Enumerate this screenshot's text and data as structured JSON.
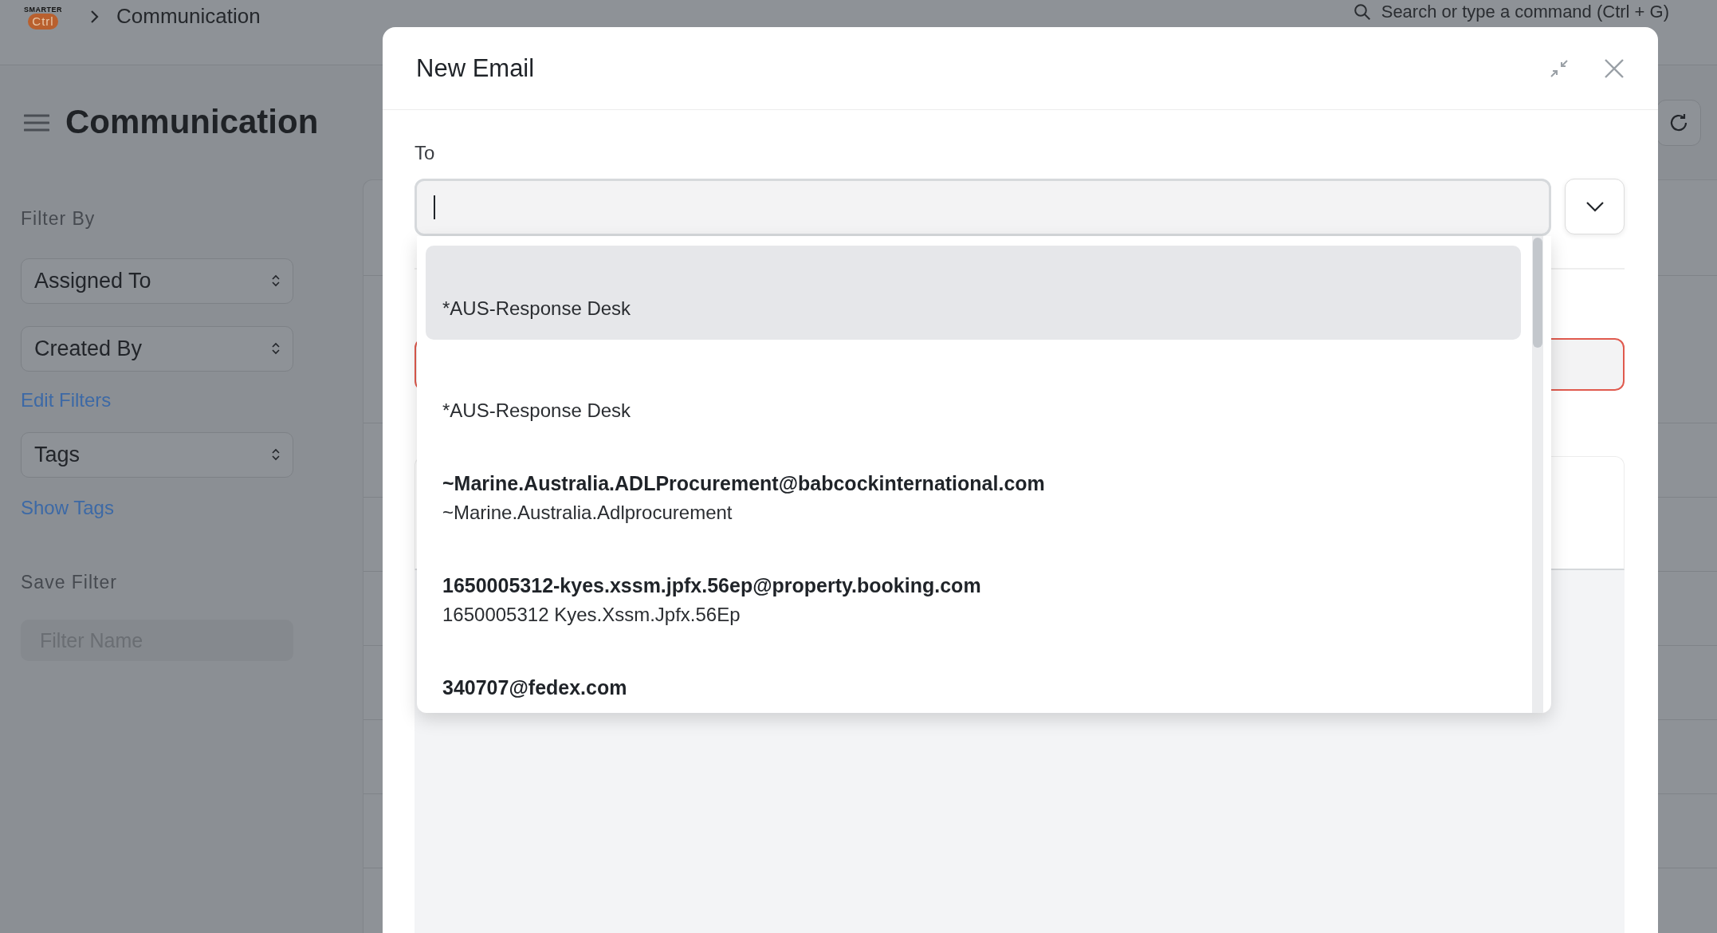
{
  "navbar": {
    "logo": {
      "top": "SMARTER",
      "main": "Ctrl"
    },
    "breadcrumb": "Communication",
    "search_placeholder": "Search or type a command (Ctrl + G)"
  },
  "page": {
    "title": "Communication"
  },
  "sidebar": {
    "filter_heading": "Filter By",
    "filters": [
      {
        "label": "Assigned To"
      },
      {
        "label": "Created By"
      }
    ],
    "edit_filters_link": "Edit Filters",
    "tags_select": "Tags",
    "show_tags_link": "Show Tags",
    "save_heading": "Save Filter",
    "filter_name_placeholder": "Filter Name"
  },
  "modal": {
    "title": "New Email",
    "to_label": "To",
    "suggestions": [
      {
        "name": "*AUS-Response Desk",
        "selected": true
      },
      {
        "name": "*AUS-Response Desk",
        "selected": false
      },
      {
        "email": "~Marine.Australia.ADLProcurement@babcockinternational.com",
        "name": "~Marine.Australia.Adlprocurement",
        "selected": false
      },
      {
        "email": "1650005312-kyes.xssm.jpfx.56ep@property.booking.com",
        "name": "1650005312 Kyes.Xssm.Jpfx.56Ep",
        "selected": false
      },
      {
        "email": "340707@fedex.com",
        "selected": false
      }
    ]
  }
}
